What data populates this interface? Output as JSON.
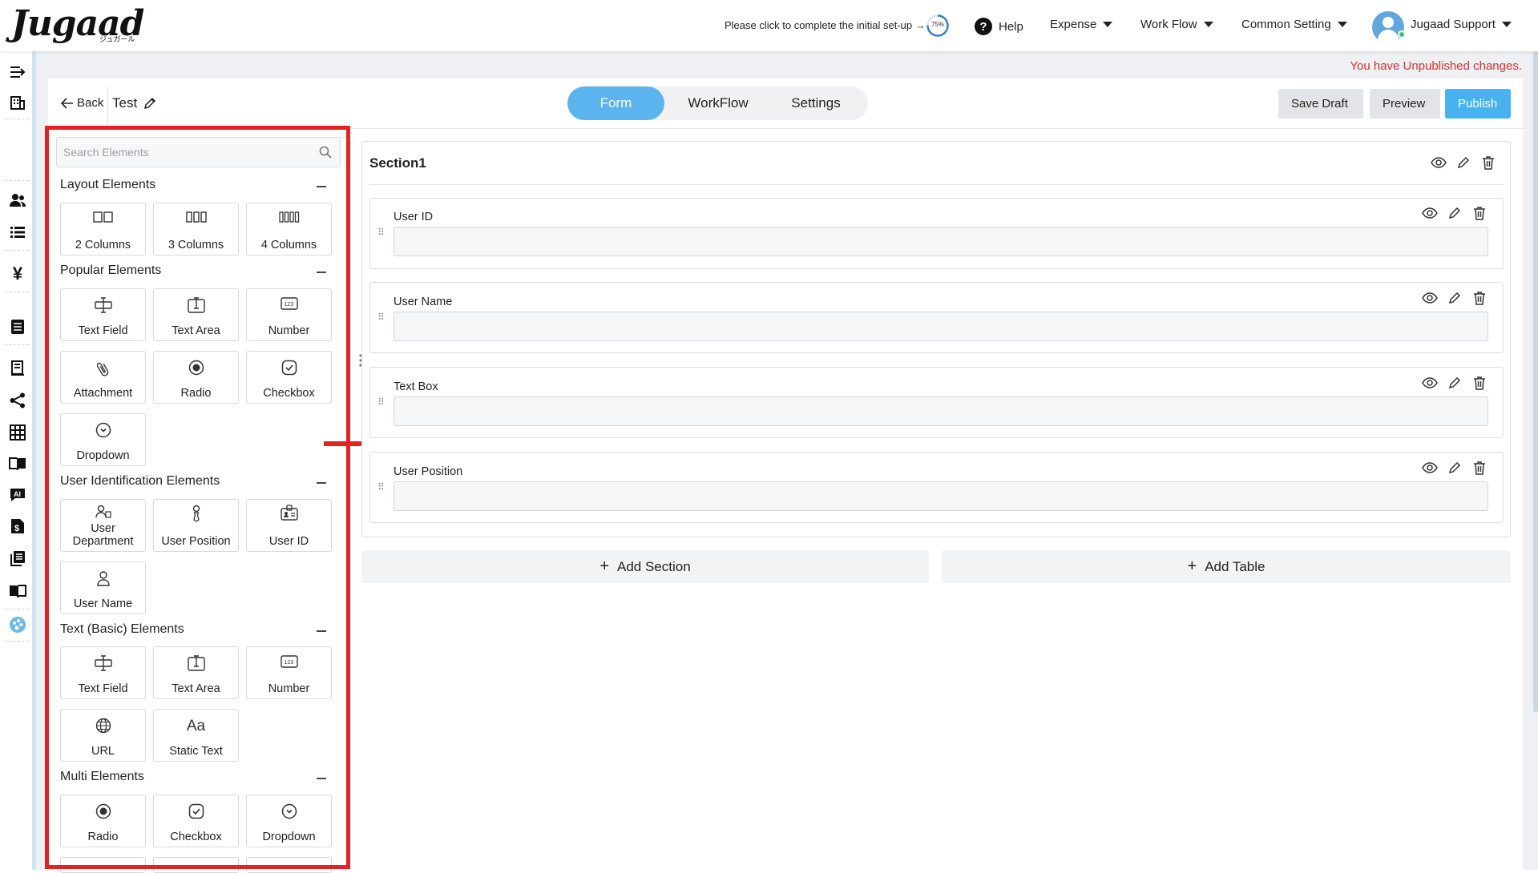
{
  "app": {
    "logo_text": "Jugaad",
    "logo_sub": "ジュガール",
    "setup_prompt": "Please click to complete the initial set-up →",
    "setup_progress": "75%",
    "setup_progress_value": 0.75
  },
  "nav": {
    "help": "Help",
    "expense": "Expense",
    "workflow": "Work Flow",
    "common_setting": "Common Setting",
    "user": "Jugaad Support"
  },
  "notice": "You have Unpublished changes.",
  "editor": {
    "back": "Back",
    "form_name": "Test",
    "tabs": [
      "Form",
      "WorkFlow",
      "Settings"
    ],
    "active_tab": "Form",
    "save_draft": "Save Draft",
    "preview": "Preview",
    "publish": "Publish"
  },
  "sidebar": {
    "search_placeholder": "Search Elements",
    "groups": [
      {
        "title": "Layout Elements",
        "items": [
          "2 Columns",
          "3 Columns",
          "4 Columns"
        ]
      },
      {
        "title": "Popular Elements",
        "items": [
          "Text Field",
          "Text Area",
          "Number",
          "Attachment",
          "Radio",
          "Checkbox",
          "Dropdown"
        ]
      },
      {
        "title": "User Identification Elements",
        "items": [
          "User Department",
          "User Position",
          "User ID",
          "User Name"
        ]
      },
      {
        "title": "Text (Basic) Elements",
        "items": [
          "Text Field",
          "Text Area",
          "Number",
          "URL",
          "Static Text"
        ]
      },
      {
        "title": "Multi Elements",
        "items": [
          "Radio",
          "Checkbox",
          "Dropdown"
        ]
      }
    ],
    "user_department_lines": [
      "User",
      "Department"
    ]
  },
  "canvas": {
    "section_title": "Section1",
    "fields": [
      "User ID",
      "User Name",
      "Text Box",
      "User Position"
    ],
    "add_section": "Add Section",
    "add_table": "Add Table"
  },
  "colors": {
    "accent": "#47b2ef",
    "tab_active": "#5cb4ef",
    "warning": "#d9302c",
    "highlight": "#e42222"
  },
  "icons": {
    "text_aa": "Aa"
  }
}
